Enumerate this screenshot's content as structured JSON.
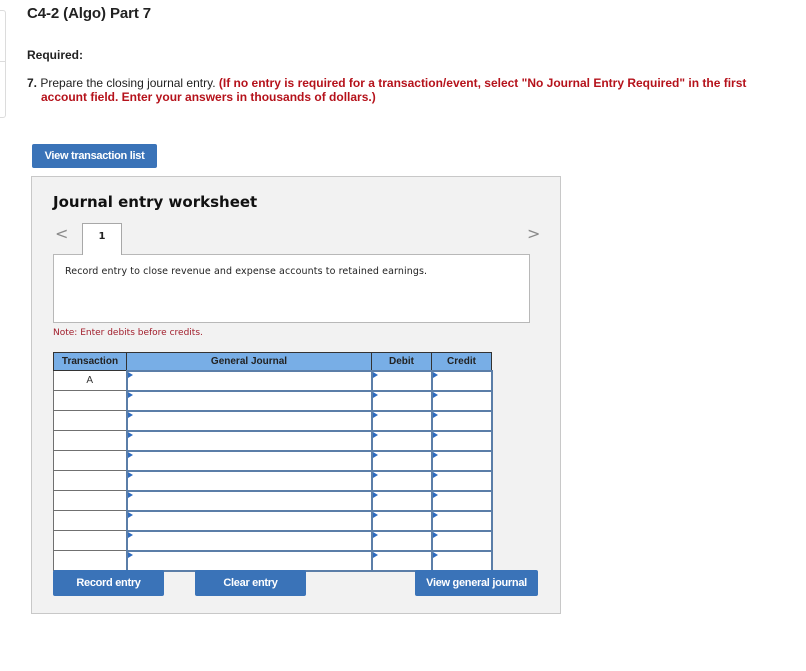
{
  "page": {
    "title": "C4-2 (Algo) Part 7",
    "required_label": "Required:",
    "instruction": {
      "number": "7.",
      "text": " Prepare the closing journal entry. ",
      "hint_line1": "(If no entry is required for a transaction/event, select \"No Journal Entry Required\" in the first",
      "hint_line2": "account field. Enter your answers in thousands of dollars.)"
    }
  },
  "buttons": {
    "view_transaction_list": "View transaction list",
    "record_entry": "Record entry",
    "clear_entry": "Clear entry",
    "view_general_journal": "View general journal"
  },
  "worksheet": {
    "title": "Journal entry worksheet",
    "nav_prev": "<",
    "nav_next": ">",
    "active_tab": "1",
    "description": "Record entry to close revenue and expense accounts to retained earnings.",
    "note": "Note: Enter debits before credits.",
    "table": {
      "headers": [
        "Transaction",
        "General Journal",
        "Debit",
        "Credit"
      ],
      "rows": [
        {
          "transaction": "A",
          "account": "",
          "debit": "",
          "credit": ""
        },
        {
          "transaction": "",
          "account": "",
          "debit": "",
          "credit": ""
        },
        {
          "transaction": "",
          "account": "",
          "debit": "",
          "credit": ""
        },
        {
          "transaction": "",
          "account": "",
          "debit": "",
          "credit": ""
        },
        {
          "transaction": "",
          "account": "",
          "debit": "",
          "credit": ""
        },
        {
          "transaction": "",
          "account": "",
          "debit": "",
          "credit": ""
        },
        {
          "transaction": "",
          "account": "",
          "debit": "",
          "credit": ""
        },
        {
          "transaction": "",
          "account": "",
          "debit": "",
          "credit": ""
        },
        {
          "transaction": "",
          "account": "",
          "debit": "",
          "credit": ""
        },
        {
          "transaction": "",
          "account": "",
          "debit": "",
          "credit": ""
        }
      ]
    }
  },
  "colors": {
    "button_blue": "#3a73b8",
    "header_blue": "#78aee6",
    "hint_red": "#b5121b",
    "input_border": "#5b7ea8"
  }
}
